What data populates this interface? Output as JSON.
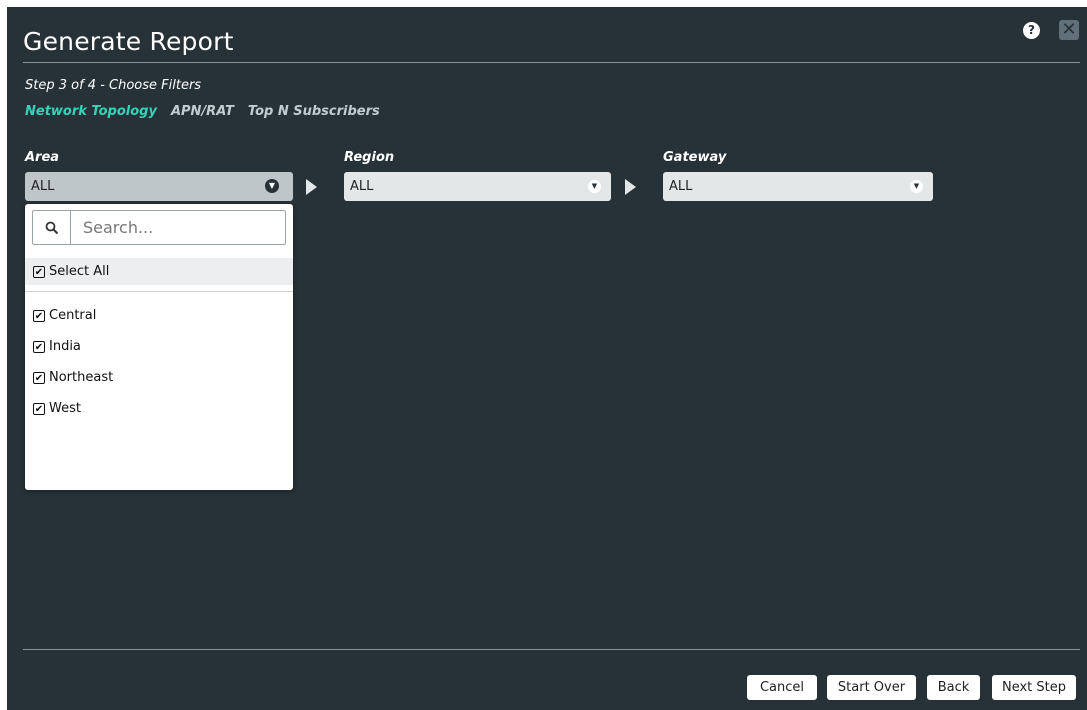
{
  "dialog": {
    "title": "Generate Report",
    "help_icon": "question-circle-icon",
    "close_icon": "close-x-icon",
    "step": "Step 3 of 4 - Choose Filters",
    "tabs": [
      {
        "label": "Network Topology",
        "active": true
      },
      {
        "label": "APN/RAT",
        "active": false
      },
      {
        "label": "Top N Subscribers",
        "active": false
      }
    ]
  },
  "filters": {
    "area": {
      "label": "Area",
      "value": "ALL"
    },
    "region": {
      "label": "Region",
      "value": "ALL"
    },
    "gateway": {
      "label": "Gateway",
      "value": "ALL"
    }
  },
  "dropdown": {
    "search_placeholder": "Search...",
    "select_all": {
      "label": "Select All",
      "checked": true
    },
    "items": [
      {
        "label": "Central",
        "checked": true
      },
      {
        "label": "India",
        "checked": true
      },
      {
        "label": "Northeast",
        "checked": true
      },
      {
        "label": "West",
        "checked": true
      }
    ]
  },
  "footer": {
    "cancel": "Cancel",
    "start_over": "Start Over",
    "back": "Back",
    "next_step": "Next Step"
  },
  "colors": {
    "background": "#263238",
    "accent": "#31d6b9"
  }
}
